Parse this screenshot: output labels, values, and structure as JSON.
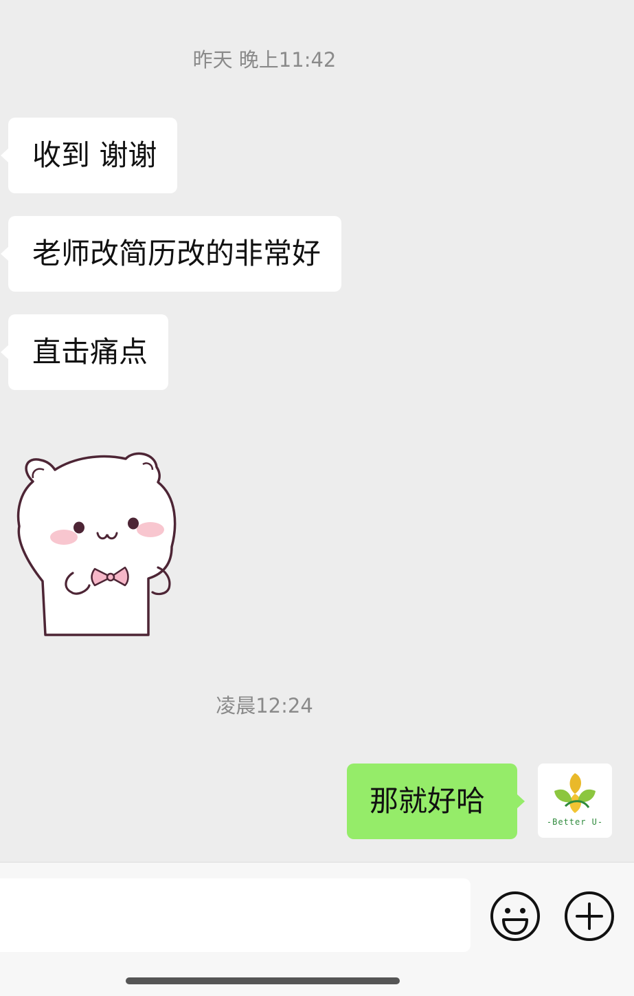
{
  "chat": {
    "timestamps": [
      "昨天 晚上11:42",
      "凌晨12:24"
    ],
    "messages": [
      {
        "sender": "other",
        "type": "text",
        "text": "收到 谢谢"
      },
      {
        "sender": "other",
        "type": "text",
        "text": "老师改简历改的非常好"
      },
      {
        "sender": "other",
        "type": "text",
        "text": "直击痛点"
      },
      {
        "sender": "other",
        "type": "sticker",
        "icon": "white-bear-bowtie-sticker"
      },
      {
        "sender": "me",
        "type": "text",
        "text": "那就好哈"
      }
    ],
    "my_avatar": {
      "icon": "better-u-logo",
      "text": "-Better U-"
    }
  },
  "input_bar": {
    "value": "",
    "placeholder": "",
    "emoji_icon": "smiley-face-icon",
    "more_icon": "plus-circle-icon"
  },
  "colors": {
    "background": "#ededed",
    "incoming_bubble": "#ffffff",
    "outgoing_bubble": "#95ec69",
    "timestamp": "#8a8a8a"
  }
}
